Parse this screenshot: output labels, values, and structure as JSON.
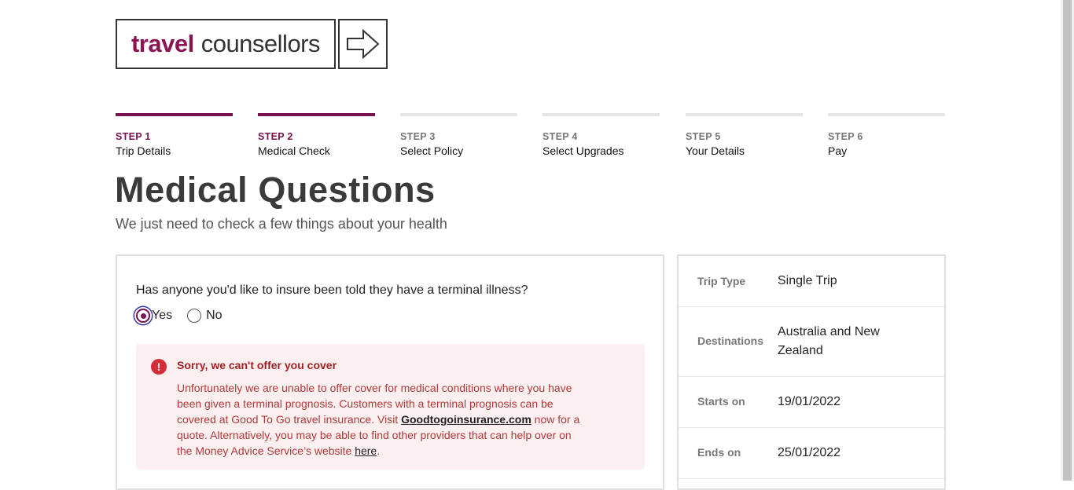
{
  "logo": {
    "brand": "travel",
    "rest": "counsellors"
  },
  "steps": [
    {
      "num": "STEP 1",
      "label": "Trip Details",
      "active": true
    },
    {
      "num": "STEP 2",
      "label": "Medical Check",
      "active": true
    },
    {
      "num": "STEP 3",
      "label": "Select Policy",
      "active": false
    },
    {
      "num": "STEP 4",
      "label": "Select Upgrades",
      "active": false
    },
    {
      "num": "STEP 5",
      "label": "Your Details",
      "active": false
    },
    {
      "num": "STEP 6",
      "label": "Pay",
      "active": false
    }
  ],
  "page": {
    "title": "Medical Questions",
    "subtitle": "We just need to check a few things about your health"
  },
  "question": {
    "text": "Has anyone you'd like to insure been told they have a terminal illness?",
    "options": [
      {
        "label": "Yes",
        "checked": true
      },
      {
        "label": "No",
        "checked": false
      }
    ]
  },
  "alert": {
    "icon": "error-icon",
    "title": "Sorry, we can't offer you cover",
    "body_1": "Unfortunately we are unable to offer cover for medical conditions where you have been given a terminal prognosis. Customers with a terminal prognosis can be covered at Good To Go travel insurance. Visit ",
    "link_1": "Goodtogoinsurance.com",
    "body_2": " now for a quote. Alternatively, you may be able to find other providers that can help over on the Money Advice Service’s website ",
    "link_2": "here",
    "body_3": "."
  },
  "summary": [
    {
      "key": "Trip Type",
      "value": "Single Trip"
    },
    {
      "key": "Destinations",
      "value": "Australia and New Zealand"
    },
    {
      "key": "Starts on",
      "value": "19/01/2022"
    },
    {
      "key": "Ends on",
      "value": "25/01/2022"
    }
  ],
  "colors": {
    "brand": "#7a1450",
    "alert_bg": "#fcefef",
    "alert_text": "#b03a3a",
    "alert_icon": "#d32f3a"
  }
}
